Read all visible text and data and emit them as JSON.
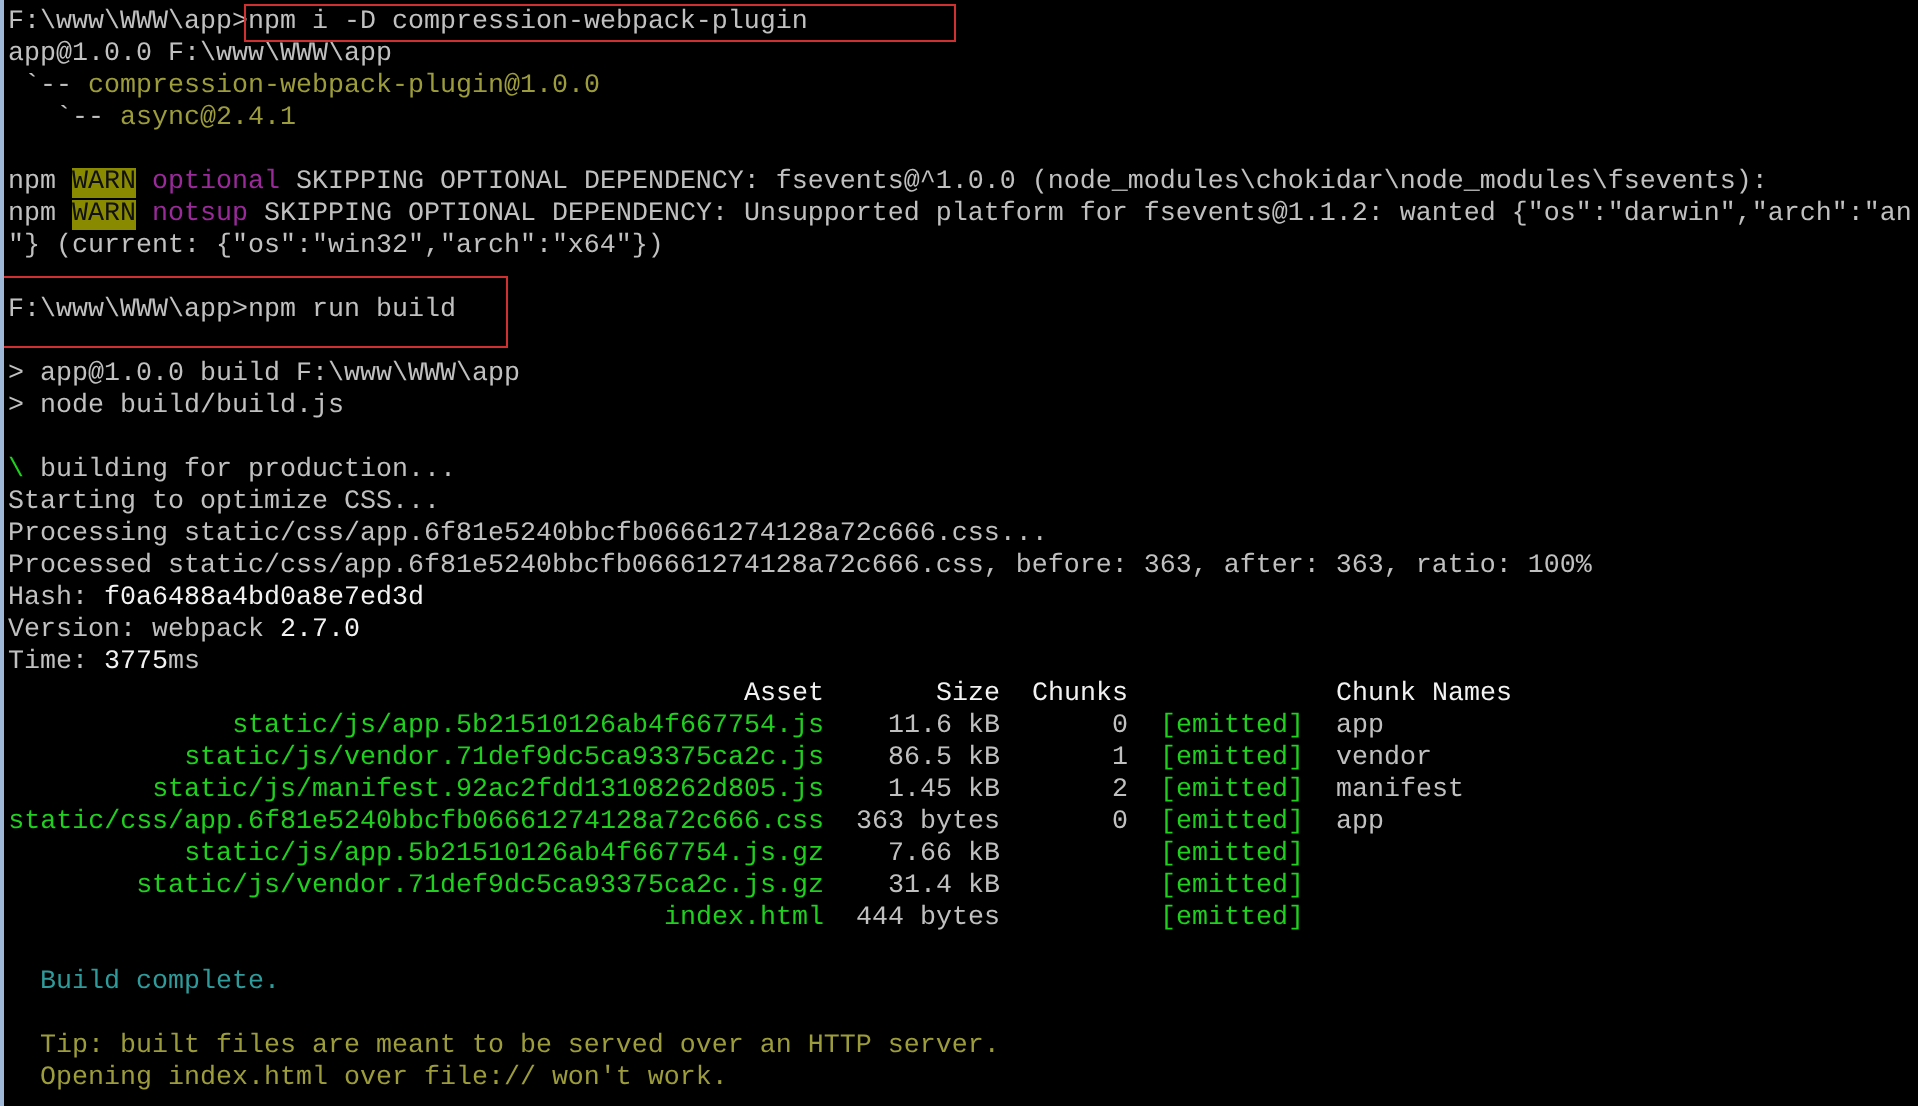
{
  "lines": [
    {
      "segments": [
        {
          "text": "F:\\www\\WWW\\app>",
          "kind": "text"
        },
        {
          "text": "npm i -D compression-webpack-plugin",
          "kind": "text",
          "boxed": true
        }
      ]
    },
    {
      "segments": [
        {
          "text": "app@1.0.0 F:\\www\\WWW\\app",
          "kind": "text"
        }
      ]
    },
    {
      "segments": [
        {
          "text": " `-- ",
          "kind": "text"
        },
        {
          "text": "compression-webpack-plugin@1.0.0",
          "kind": "package"
        }
      ]
    },
    {
      "segments": [
        {
          "text": "   `-- ",
          "kind": "text"
        },
        {
          "text": "async@2.4.1",
          "kind": "package"
        }
      ]
    },
    {
      "spaced_before": true,
      "segments": [
        {
          "text": "npm ",
          "kind": "text"
        },
        {
          "text": "WARN",
          "kind": "warning"
        },
        {
          "text": " optional",
          "kind": "tag"
        },
        {
          "text": " SKIPPING OPTIONAL DEPENDENCY: fsevents@^1.0.0 (node_modules\\chokidar\\node_modules\\fsevents):",
          "kind": "text"
        }
      ]
    },
    {
      "segments": [
        {
          "text": "npm ",
          "kind": "text"
        },
        {
          "text": "WARN",
          "kind": "warning"
        },
        {
          "text": " notsup",
          "kind": "tag"
        },
        {
          "text": " SKIPPING OPTIONAL DEPENDENCY: Unsupported platform for fsevents@1.1.2: wanted {\"os\":\"darwin\",\"arch\":\"an",
          "kind": "text"
        }
      ]
    },
    {
      "segments": [
        {
          "text": "\"} (current: {\"os\":\"win32\",\"arch\":\"x64\"})",
          "kind": "text"
        }
      ]
    },
    {
      "spaced_before": true,
      "boxed": true,
      "segments": [
        {
          "text": "F:\\www\\WWW\\app>npm run build",
          "kind": "text"
        }
      ]
    },
    {
      "spaced_before": true,
      "segments": [
        {
          "text": "> app@1.0.0 build F:\\www\\WWW\\app",
          "kind": "text"
        }
      ]
    },
    {
      "segments": [
        {
          "text": "> node build/build.js",
          "kind": "text"
        }
      ]
    },
    {
      "spaced_before": true,
      "segments": [
        {
          "text": "\\",
          "kind": "spinner"
        },
        {
          "text": " building for production...",
          "kind": "text"
        }
      ]
    },
    {
      "segments": [
        {
          "text": "Starting to optimize CSS...",
          "kind": "text"
        }
      ]
    },
    {
      "segments": [
        {
          "text": "Processing static/css/app.6f81e5240bbcfb06661274128a72c666.css...",
          "kind": "text"
        }
      ]
    },
    {
      "segments": [
        {
          "text": "Processed static/css/app.6f81e5240bbcfb06661274128a72c666.css, before: 363, after: 363, ratio: 100%",
          "kind": "text"
        }
      ]
    },
    {
      "segments": [
        {
          "text": "Hash: ",
          "kind": "text"
        },
        {
          "text": "f0a6488a4bd0a8e7ed3d",
          "kind": "value"
        }
      ]
    },
    {
      "segments": [
        {
          "text": "Version: webpack ",
          "kind": "text"
        },
        {
          "text": "2.7.0",
          "kind": "value"
        }
      ]
    },
    {
      "segments": [
        {
          "text": "Time: ",
          "kind": "text"
        },
        {
          "text": "3775",
          "kind": "value"
        },
        {
          "text": "ms",
          "kind": "text"
        }
      ]
    }
  ],
  "table": {
    "columns": {
      "asset": "Asset",
      "size": "Size",
      "chunks": "Chunks",
      "chunk_names": "Chunk Names"
    },
    "rows": [
      {
        "asset": "static/js/app.5b21510126ab4f667754.js",
        "size": "11.6 kB",
        "chunks": "0",
        "status": "[emitted]",
        "chunk_names": "app"
      },
      {
        "asset": "static/js/vendor.71def9dc5ca93375ca2c.js",
        "size": "86.5 kB",
        "chunks": "1",
        "status": "[emitted]",
        "chunk_names": "vendor"
      },
      {
        "asset": "static/js/manifest.92ac2fdd13108262d805.js",
        "size": "1.45 kB",
        "chunks": "2",
        "status": "[emitted]",
        "chunk_names": "manifest"
      },
      {
        "asset": "static/css/app.6f81e5240bbcfb06661274128a72c666.css",
        "size": "363 bytes",
        "chunks": "0",
        "status": "[emitted]",
        "chunk_names": "app"
      },
      {
        "asset": "static/js/app.5b21510126ab4f667754.js.gz",
        "size": "7.66 kB",
        "status": "[emitted]"
      },
      {
        "asset": "static/js/vendor.71def9dc5ca93375ca2c.js.gz",
        "size": "31.4 kB",
        "status": "[emitted]"
      },
      {
        "asset": "index.html",
        "size": "444 bytes",
        "status": "[emitted]"
      }
    ]
  },
  "footer_lines": [
    {
      "spaced_before": true,
      "segments": [
        {
          "text": "  Build complete.",
          "kind": "success"
        }
      ]
    },
    {
      "spaced_before": true,
      "segments": [
        {
          "text": "  Tip: built files are meant to be served over an HTTP server.",
          "kind": "tip"
        }
      ]
    },
    {
      "segments": [
        {
          "text": "  Opening index.html over file:// won't work.",
          "kind": "tip"
        }
      ]
    }
  ]
}
